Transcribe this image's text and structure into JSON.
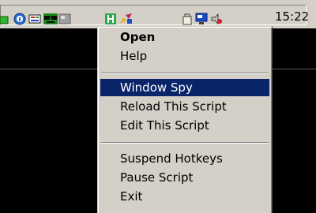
{
  "taskbar": {
    "clock": "15:22",
    "tray_icons": [
      "green-icon",
      "blue-info-icon",
      "network-card-icon",
      "sunglasses-icon",
      "grey-app-icon",
      "green-h-icon",
      "pen-tool-icon",
      "bag-icon",
      "monitor-icon",
      "speaker-volume-icon"
    ]
  },
  "context_menu": {
    "items": [
      {
        "label": "Open"
      },
      {
        "label": "Help"
      },
      {
        "label": "Window Spy"
      },
      {
        "label": "Reload This Script"
      },
      {
        "label": "Edit This Script"
      },
      {
        "label": "Suspend Hotkeys"
      },
      {
        "label": "Pause Script"
      },
      {
        "label": "Exit"
      }
    ],
    "selected_item": "Window Spy",
    "colors": {
      "menu_background": "#d4d0c8",
      "highlight": "#0a246a",
      "highlight_text": "#ffffff"
    }
  }
}
